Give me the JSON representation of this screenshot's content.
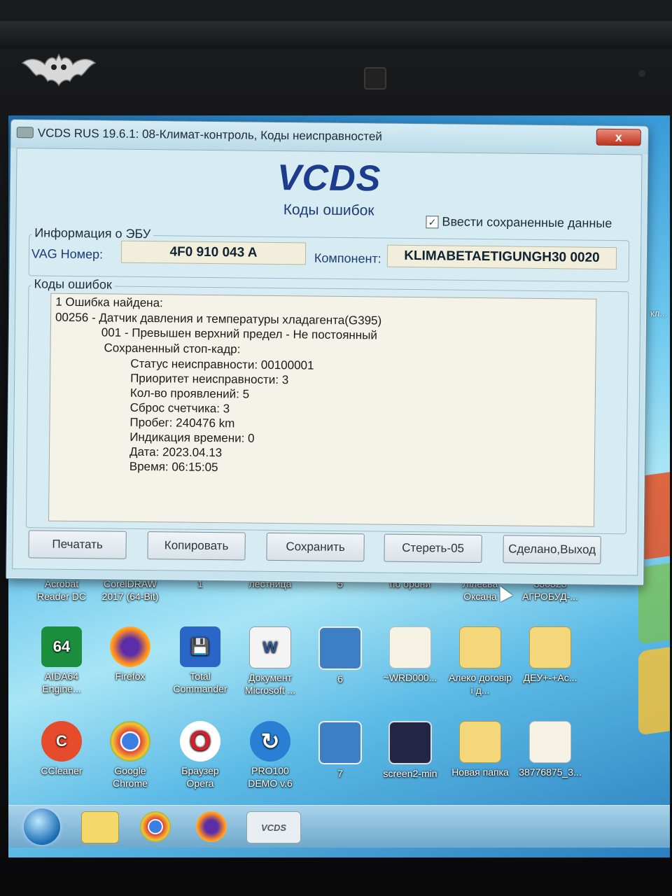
{
  "window": {
    "title": "VCDS RUS 19.6.1: 08-Климат-контроль,  Коды неисправностей",
    "close_label": "x",
    "app_title": "VCDS",
    "app_subtitle": "Коды ошибок",
    "stored_data_checkbox": {
      "label": "Ввести сохраненные данные",
      "checked": true,
      "mark": "✓"
    }
  },
  "ecu_info": {
    "legend": "Информация о ЭБУ",
    "vag_label": "VAG Номер:",
    "vag_value": "4F0 910 043 A",
    "component_label": "Компонент:",
    "component_value": "KLIMABETAETIGUNGH30 0020"
  },
  "fault_codes": {
    "legend": "Коды ошибок",
    "lines": [
      "1 Ошибка найдена:",
      "00256 - Датчик давления и температуры хладагента(G395)",
      "001 - Превышен верхний предел - Не постоянный",
      "Сохраненный стоп-кадр:",
      "Статус неисправности: 00100001",
      "Приоритет неисправности: 3",
      "Кол-во проявлений: 5",
      "Сброс счетчика: 3",
      "Пробег: 240476 km",
      "Индикация времени: 0",
      "Дата: 2023.04.13",
      "Время: 06:15:05"
    ]
  },
  "buttons": {
    "print": "Печатать",
    "copy": "Копировать",
    "save": "Сохранить",
    "clear": "Стереть-05",
    "done": "Сделано,Выход"
  },
  "desktop": {
    "right_edge_label": "кл...",
    "row1": [
      "Acrobat Reader DC",
      "CorelDRAW 2017 (64-Bit)",
      "1",
      "лестница",
      "5",
      "по брони",
      "Лілеєва Оксана",
      "330323 АГРОБУД-..."
    ],
    "row2": [
      {
        "label": "AIDA64 Engine...",
        "icon": "aida64-icon",
        "glyph": "64"
      },
      {
        "label": "Firefox",
        "icon": "firefox-icon",
        "glyph": ""
      },
      {
        "label": "Total Commander",
        "icon": "floppy-icon",
        "glyph": "💾"
      },
      {
        "label": "Документ Microsoft ...",
        "icon": "word-doc-icon",
        "glyph": "W"
      },
      {
        "label": "6",
        "icon": "image-file-icon",
        "glyph": ""
      },
      {
        "label": "~WRD000...",
        "icon": "blank-file-icon",
        "glyph": ""
      },
      {
        "label": "Алеко договір і д...",
        "icon": "folder-icon",
        "glyph": ""
      },
      {
        "label": "ДЕУ+-+Ас...",
        "icon": "folder-icon",
        "glyph": ""
      }
    ],
    "row3": [
      {
        "label": "CCleaner",
        "icon": "ccleaner-icon",
        "glyph": "C"
      },
      {
        "label": "Google Chrome",
        "icon": "chrome-icon",
        "glyph": ""
      },
      {
        "label": "Браузер Opera",
        "icon": "opera-icon",
        "glyph": "O"
      },
      {
        "label": "PRO100 DEMO v.6",
        "icon": "pro100-icon",
        "glyph": "↻"
      },
      {
        "label": "7",
        "icon": "image-file-icon",
        "glyph": ""
      },
      {
        "label": "screen2-min",
        "icon": "screenshot-file-icon",
        "glyph": ""
      },
      {
        "label": "Новая папка",
        "icon": "folder-icon",
        "glyph": ""
      },
      {
        "label": "38776875_3...",
        "icon": "blank-file-icon",
        "glyph": ""
      }
    ]
  },
  "taskbar": {
    "vcds_label": "VCDS",
    "items": [
      "windows-start-icon",
      "explorer-icon",
      "chrome-icon",
      "firefox-icon",
      "vcds-icon"
    ]
  },
  "colors": {
    "title_blue": "#1d3c8c",
    "field_bg": "#f1efdc",
    "close_red": "#c1331d"
  }
}
